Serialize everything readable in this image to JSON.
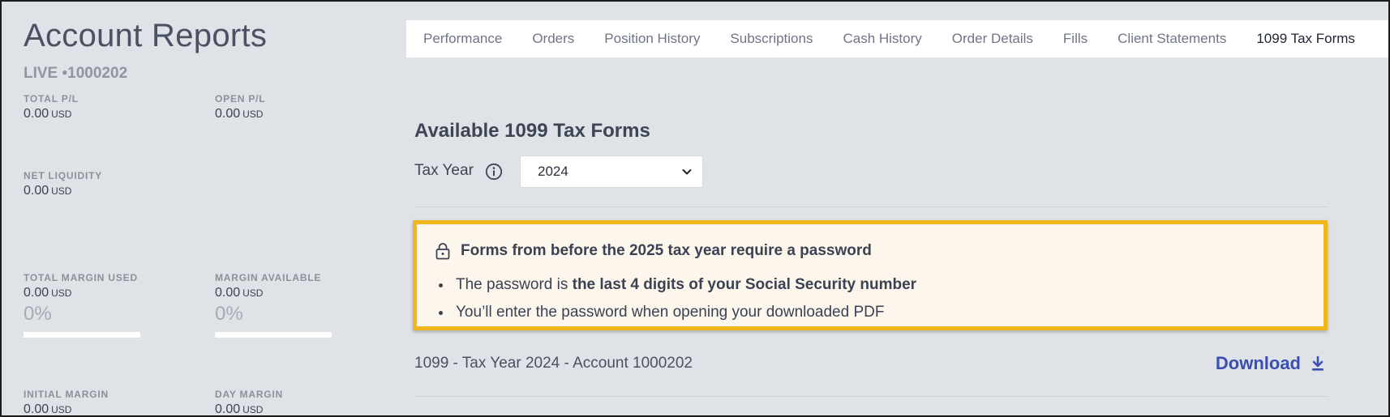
{
  "page": {
    "title": "Account Reports",
    "account_id": "LIVE •1000202"
  },
  "metrics": {
    "total_pl": {
      "label": "TOTAL P/L",
      "value": "0.00",
      "unit": "USD"
    },
    "open_pl": {
      "label": "OPEN P/L",
      "value": "0.00",
      "unit": "USD"
    },
    "net_liquidity": {
      "label": "NET LIQUIDITY",
      "value": "0.00",
      "unit": "USD"
    },
    "total_margin_used": {
      "label": "TOTAL MARGIN USED",
      "value": "0.00",
      "unit": "USD",
      "percent": "0%",
      "bar_fraction": 0.0
    },
    "margin_available": {
      "label": "MARGIN AVAILABLE",
      "value": "0.00",
      "unit": "USD",
      "percent": "0%",
      "bar_fraction": 0.0
    },
    "initial_margin": {
      "label": "INITIAL MARGIN",
      "value": "0.00",
      "unit": "USD"
    },
    "day_margin": {
      "label": "DAY MARGIN",
      "value": "0.00",
      "unit": "USD"
    }
  },
  "tabs": [
    {
      "label": "Performance"
    },
    {
      "label": "Orders"
    },
    {
      "label": "Position History"
    },
    {
      "label": "Subscriptions"
    },
    {
      "label": "Cash History"
    },
    {
      "label": "Order Details"
    },
    {
      "label": "Fills"
    },
    {
      "label": "Client Statements"
    },
    {
      "label": "1099 Tax Forms",
      "active": true
    }
  ],
  "tax_forms": {
    "title": "Available 1099 Tax Forms",
    "tax_year_label": "Tax Year",
    "selected_year": "2024",
    "notice": {
      "heading": "Forms from before the 2025 tax year require a password",
      "bullet1_prefix": "The password is ",
      "bullet1_bold": "the last 4 digits of your Social Security number",
      "bullet2": "You’ll enter the password when opening your downloaded PDF"
    },
    "file_label": "1099 - Tax Year 2024 - Account 1000202",
    "download_label": "Download"
  },
  "icons": {
    "info": "info-circle-icon",
    "lock": "lock-icon",
    "chevron": "chevron-down-icon",
    "download": "download-icon"
  },
  "colors": {
    "accent_link": "#3b4fb0",
    "notice_border": "#f0b61c",
    "notice_bg": "#fdf6ec",
    "page_bg": "#dfe2e7"
  }
}
